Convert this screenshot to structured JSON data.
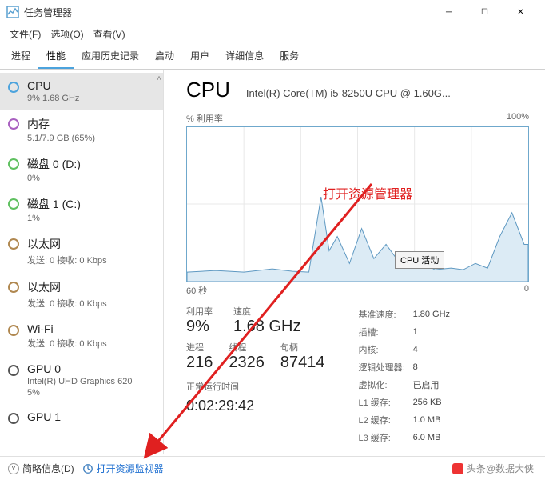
{
  "window": {
    "title": "任务管理器"
  },
  "menubar": [
    "文件(F)",
    "选项(O)",
    "查看(V)"
  ],
  "tabs": [
    "进程",
    "性能",
    "应用历史记录",
    "启动",
    "用户",
    "详细信息",
    "服务"
  ],
  "activeTab": 1,
  "sidebar": [
    {
      "title": "CPU",
      "sub": "9%  1.68 GHz",
      "ring": "blue",
      "sel": true
    },
    {
      "title": "内存",
      "sub": "5.1/7.9 GB (65%)",
      "ring": "purple"
    },
    {
      "title": "磁盘 0 (D:)",
      "sub": "0%",
      "ring": "green"
    },
    {
      "title": "磁盘 1 (C:)",
      "sub": "1%",
      "ring": "green"
    },
    {
      "title": "以太网",
      "sub": "发送: 0 接收: 0 Kbps",
      "ring": "brown"
    },
    {
      "title": "以太网",
      "sub": "发送: 0 接收: 0 Kbps",
      "ring": "brown"
    },
    {
      "title": "Wi-Fi",
      "sub": "发送: 0 接收: 0 Kbps",
      "ring": "brown"
    },
    {
      "title": "GPU 0",
      "sub": "Intel(R) UHD Graphics 620\n5%",
      "ring": "dark"
    },
    {
      "title": "GPU 1",
      "sub": "",
      "ring": "dark"
    }
  ],
  "cpu": {
    "label": "CPU",
    "name": "Intel(R) Core(TM) i5-8250U CPU @ 1.60G...",
    "utilLabel": "% 利用率",
    "utilMax": "100%",
    "xLeft": "60 秒",
    "xRight": "0",
    "tooltip": "CPU 活动",
    "annotation": "打开资源管理器",
    "stats1": [
      {
        "lbl": "利用率",
        "val": "9%"
      },
      {
        "lbl": "速度",
        "val": "1.68 GHz"
      }
    ],
    "stats2": [
      {
        "lbl": "进程",
        "val": "216"
      },
      {
        "lbl": "线程",
        "val": "2326"
      },
      {
        "lbl": "句柄",
        "val": "87414"
      }
    ],
    "uptimeLabel": "正常运行时间",
    "uptime": "0:02:29:42",
    "right": [
      [
        "基准速度:",
        "1.80 GHz"
      ],
      [
        "插槽:",
        "1"
      ],
      [
        "内核:",
        "4"
      ],
      [
        "逻辑处理器:",
        "8"
      ],
      [
        "虚拟化:",
        "已启用"
      ],
      [
        "L1 缓存:",
        "256 KB"
      ],
      [
        "L2 缓存:",
        "1.0 MB"
      ],
      [
        "L3 缓存:",
        "6.0 MB"
      ]
    ]
  },
  "footer": {
    "brief": "简略信息(D)",
    "link": "打开资源监视器"
  },
  "watermark": "头条@数据大侠",
  "chart_data": {
    "type": "line",
    "title": "% 利用率",
    "xlabel": "秒",
    "ylabel": "%",
    "xlim": [
      60,
      0
    ],
    "ylim": [
      0,
      100
    ],
    "series": [
      {
        "name": "CPU",
        "x": [
          60,
          55,
          50,
          45,
          40,
          35,
          32,
          30,
          28,
          26,
          24,
          22,
          20,
          18,
          16,
          14,
          12,
          10,
          8,
          6,
          4,
          2,
          0
        ],
        "y": [
          6,
          7,
          6,
          8,
          7,
          6,
          55,
          20,
          30,
          12,
          35,
          15,
          25,
          10,
          15,
          8,
          10,
          8,
          12,
          9,
          30,
          45,
          25
        ]
      }
    ]
  }
}
